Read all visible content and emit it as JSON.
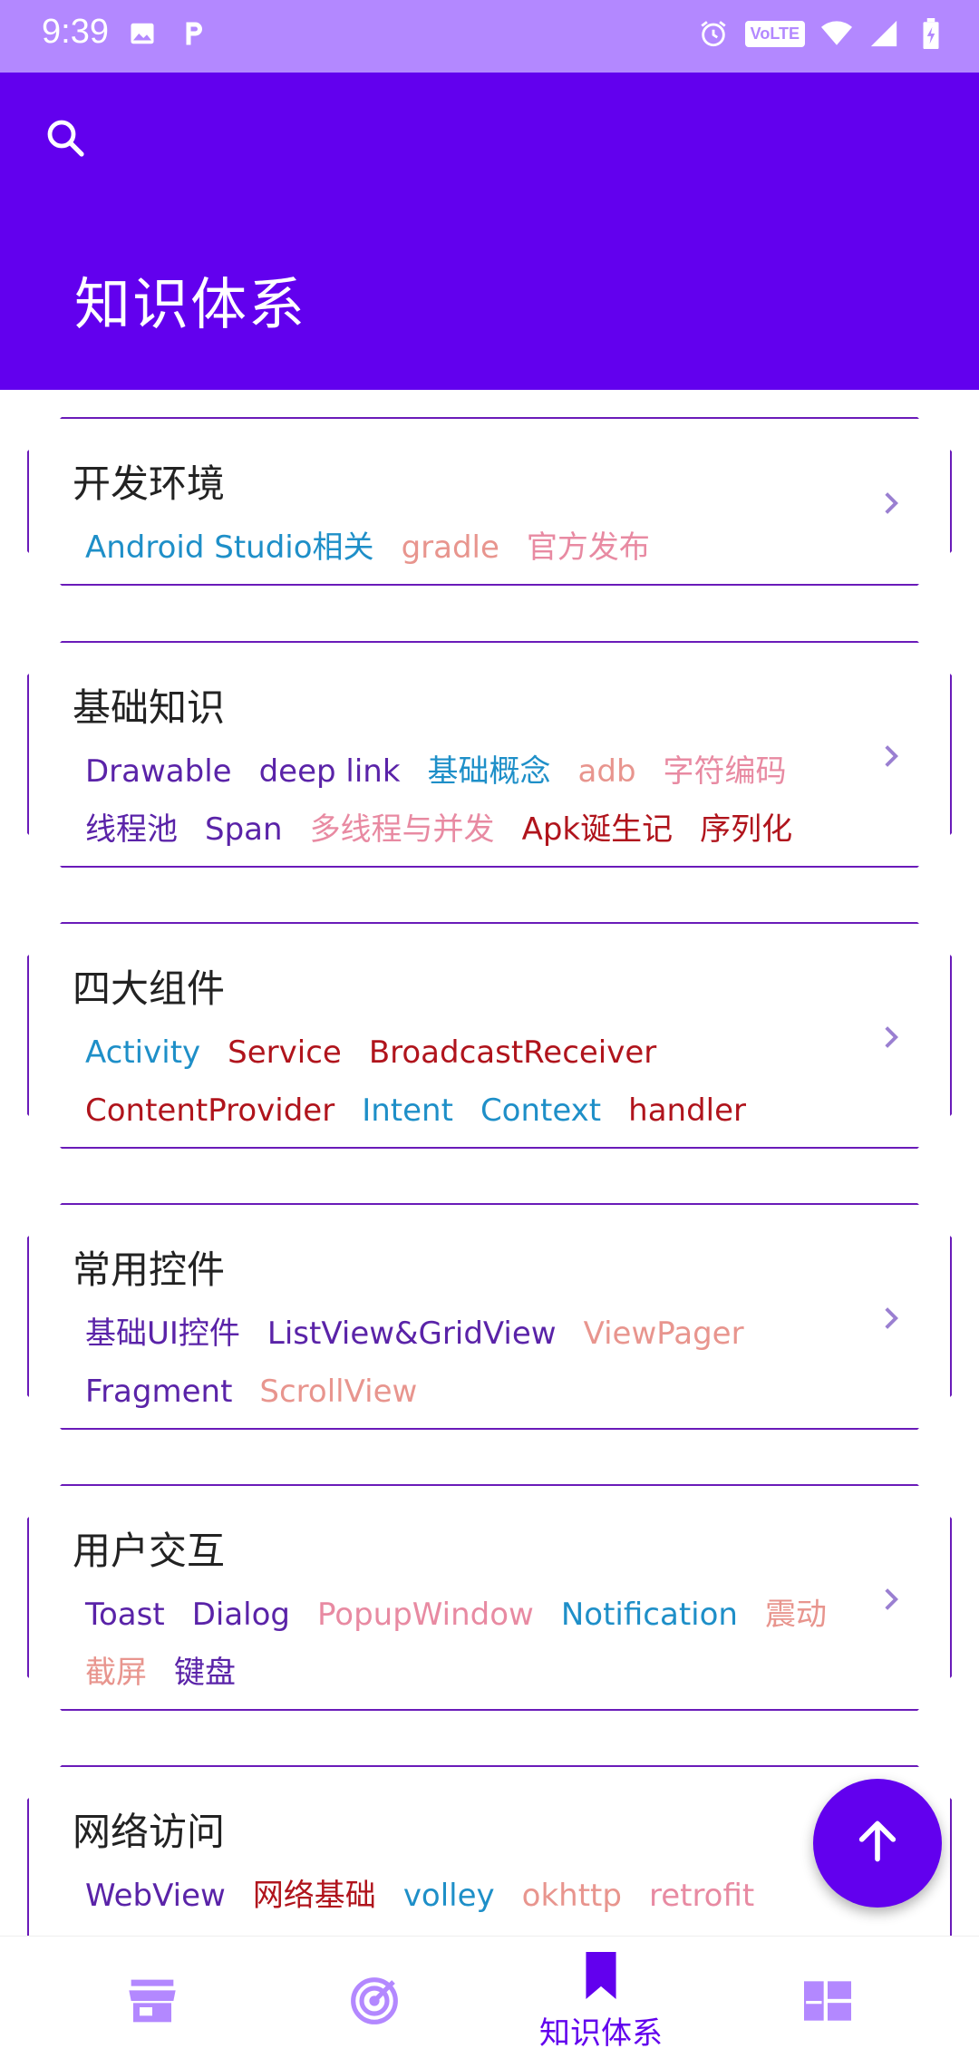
{
  "status_bar": {
    "time": "9:39",
    "left_icons": [
      "image-icon",
      "p-icon"
    ],
    "right_icons": [
      "alarm-icon",
      "volte-badge",
      "wifi-icon",
      "signal-icon",
      "battery-icon"
    ],
    "volte_label": "VoLTE",
    "background": "#b388ff"
  },
  "app_bar": {
    "search_icon": "search-icon",
    "title": "知识体系",
    "background": "#6200ee"
  },
  "colors": {
    "purple": "#5a23a8",
    "blue": "#1e8fc8",
    "salmon": "#e8958e",
    "pink": "#e88aa2",
    "red": "#b0141c",
    "card_border": "#6a1bb9"
  },
  "cards": [
    {
      "title": "开发环境",
      "tags": [
        {
          "text": "Android Studio相关",
          "color": "#1e8fc8"
        },
        {
          "text": "gradle",
          "color": "#e8958e"
        },
        {
          "text": "官方发布",
          "color": "#e88aa2"
        }
      ]
    },
    {
      "title": "基础知识",
      "tags": [
        {
          "text": "Drawable",
          "color": "#5a23a8"
        },
        {
          "text": "deep link",
          "color": "#5a23a8"
        },
        {
          "text": "基础概念",
          "color": "#1e8fc8"
        },
        {
          "text": "adb",
          "color": "#e8958e"
        },
        {
          "text": "字符编码",
          "color": "#e88aa2"
        },
        {
          "text": "线程池",
          "color": "#5a23a8"
        },
        {
          "text": "Span",
          "color": "#5a23a8"
        },
        {
          "text": "多线程与并发",
          "color": "#e88aa2"
        },
        {
          "text": "Apk诞生记",
          "color": "#b0141c"
        },
        {
          "text": "序列化",
          "color": "#b0141c"
        }
      ]
    },
    {
      "title": "四大组件",
      "tags": [
        {
          "text": "Activity",
          "color": "#1e8fc8"
        },
        {
          "text": "Service",
          "color": "#b0141c"
        },
        {
          "text": "BroadcastReceiver",
          "color": "#b0141c"
        },
        {
          "text": "ContentProvider",
          "color": "#b0141c"
        },
        {
          "text": "Intent",
          "color": "#1e8fc8"
        },
        {
          "text": "Context",
          "color": "#1e8fc8"
        },
        {
          "text": "handler",
          "color": "#b0141c"
        }
      ]
    },
    {
      "title": "常用控件",
      "tags": [
        {
          "text": "基础UI控件",
          "color": "#5a23a8"
        },
        {
          "text": "ListView&GridView",
          "color": "#5a23a8"
        },
        {
          "text": "ViewPager",
          "color": "#e8958e"
        },
        {
          "text": "Fragment",
          "color": "#5a23a8"
        },
        {
          "text": "ScrollView",
          "color": "#e8958e"
        }
      ]
    },
    {
      "title": "用户交互",
      "tags": [
        {
          "text": "Toast",
          "color": "#5a23a8"
        },
        {
          "text": "Dialog",
          "color": "#5a23a8"
        },
        {
          "text": "PopupWindow",
          "color": "#e88aa2"
        },
        {
          "text": "Notification",
          "color": "#1e8fc8"
        },
        {
          "text": "震动",
          "color": "#e8958e"
        },
        {
          "text": "截屏",
          "color": "#e8958e"
        },
        {
          "text": "键盘",
          "color": "#5a23a8"
        }
      ]
    },
    {
      "title": "网络访问",
      "tags": [
        {
          "text": "WebView",
          "color": "#5a23a8"
        },
        {
          "text": "网络基础",
          "color": "#b0141c"
        },
        {
          "text": "volley",
          "color": "#1e8fc8"
        },
        {
          "text": "okhttp",
          "color": "#e8958e"
        },
        {
          "text": "retrofit",
          "color": "#e88aa2"
        }
      ]
    }
  ],
  "fab": {
    "icon": "arrow-up-icon"
  },
  "bottom_nav": {
    "items": [
      {
        "icon": "store-icon",
        "label": ""
      },
      {
        "icon": "radar-icon",
        "label": ""
      },
      {
        "icon": "bookmark-icon",
        "label": "知识体系",
        "active": true
      },
      {
        "icon": "dashboard-icon",
        "label": ""
      }
    ],
    "active_color": "#6200ee",
    "inactive_color": "#b388ff"
  }
}
